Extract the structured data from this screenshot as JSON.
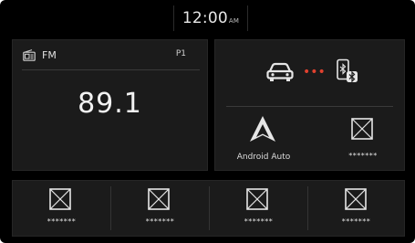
{
  "status": {
    "time": "12:00",
    "ampm": "AM"
  },
  "radio": {
    "band": "FM",
    "preset": "P1",
    "frequency": "89.1",
    "icon": "radio-icon"
  },
  "connection": {
    "car_icon": "car-icon",
    "dots": "•••",
    "phone_icon": "phone-bluetooth-icon"
  },
  "android_auto": {
    "label": "Android Auto",
    "icon": "android-auto-icon"
  },
  "right_slot": {
    "label": "*******",
    "icon": "empty-app-icon"
  },
  "bottom_tiles": [
    {
      "label": "*******",
      "icon": "empty-app-icon"
    },
    {
      "label": "*******",
      "icon": "empty-app-icon"
    },
    {
      "label": "*******",
      "icon": "empty-app-icon"
    },
    {
      "label": "*******",
      "icon": "empty-app-icon"
    }
  ],
  "colors": {
    "background": "#000000",
    "card": "#1b1b1b",
    "accent_dots": "#e0412f",
    "text": "#e8e8e8"
  }
}
